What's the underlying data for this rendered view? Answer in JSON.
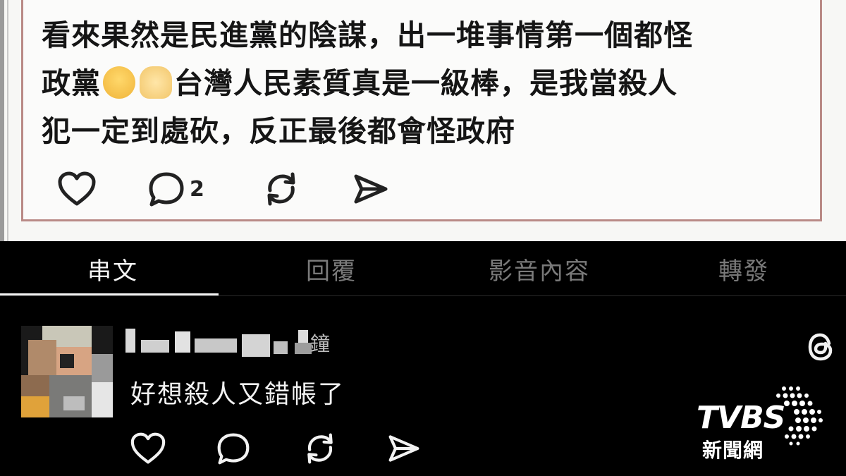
{
  "post": {
    "lines": [
      "看來果然是民進黨的陰謀，出一堆事情第一個都怪",
      "政黨",
      "台灣人民素質真是一級棒，是我當殺人",
      "犯一定到處砍，反正最後都會怪政府"
    ],
    "emoji": [
      "crying-face",
      "raised-hands"
    ],
    "comment_count": "2"
  },
  "tabs": [
    {
      "label": "串文",
      "active": true
    },
    {
      "label": "回覆",
      "active": false
    },
    {
      "label": "影音內容",
      "active": false
    },
    {
      "label": "轉發",
      "active": false
    }
  ],
  "reply": {
    "username_visible_tail": "鐘",
    "text": "好想殺人又錯帳了"
  },
  "logo": {
    "word": "TVBS",
    "sub": "新聞網"
  },
  "colors": {
    "background": "#000000",
    "active_tab": "#f3f3f3",
    "inactive_tab": "#7a7a7a",
    "post_border": "#b98a86"
  }
}
